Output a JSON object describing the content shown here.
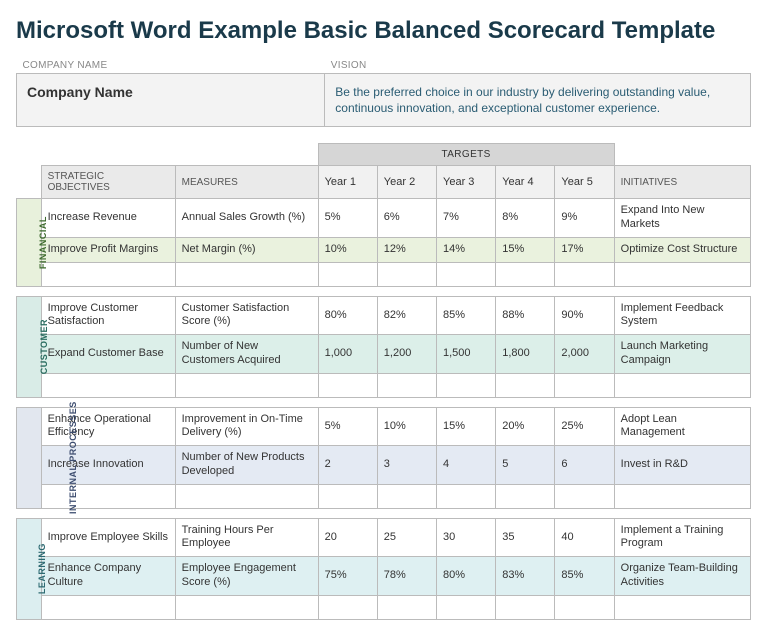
{
  "title": "Microsoft Word Example Basic Balanced Scorecard Template",
  "header": {
    "companyLabel": "COMPANY NAME",
    "visionLabel": "VISION",
    "companyName": "Company Name",
    "vision": "Be the preferred choice in our industry by delivering outstanding value, continuous innovation, and exceptional customer experience."
  },
  "columns": {
    "objectives": "STRATEGIC OBJECTIVES",
    "measures": "MEASURES",
    "targets": "TARGETS",
    "year1": "Year 1",
    "year2": "Year 2",
    "year3": "Year 3",
    "year4": "Year 4",
    "year5": "Year 5",
    "initiatives": "INITIATIVES"
  },
  "sections": {
    "financial": {
      "label": "FINANCIAL",
      "rows": [
        {
          "obj": "Increase Revenue",
          "mea": "Annual Sales Growth (%)",
          "y1": "5%",
          "y2": "6%",
          "y3": "7%",
          "y4": "8%",
          "y5": "9%",
          "ini": "Expand Into New Markets"
        },
        {
          "obj": "Improve Profit Margins",
          "mea": "Net Margin (%)",
          "y1": "10%",
          "y2": "12%",
          "y3": "14%",
          "y4": "15%",
          "y5": "17%",
          "ini": "Optimize Cost Structure"
        }
      ]
    },
    "customer": {
      "label": "CUSTOMER",
      "rows": [
        {
          "obj": "Improve Customer Satisfaction",
          "mea": "Customer Satisfaction Score (%)",
          "y1": "80%",
          "y2": "82%",
          "y3": "85%",
          "y4": "88%",
          "y5": "90%",
          "ini": "Implement Feedback System"
        },
        {
          "obj": "Expand Customer Base",
          "mea": "Number of New Customers Acquired",
          "y1": "1,000",
          "y2": "1,200",
          "y3": "1,500",
          "y4": "1,800",
          "y5": "2,000",
          "ini": "Launch Marketing Campaign"
        }
      ]
    },
    "internal": {
      "label": "INTERNAL PROCESSES",
      "rows": [
        {
          "obj": "Enhance Operational Efficiency",
          "mea": "Improvement in On-Time Delivery (%)",
          "y1": "5%",
          "y2": "10%",
          "y3": "15%",
          "y4": "20%",
          "y5": "25%",
          "ini": "Adopt Lean Management"
        },
        {
          "obj": "Increase Innovation",
          "mea": "Number of New Products Developed",
          "y1": "2",
          "y2": "3",
          "y3": "4",
          "y4": "5",
          "y5": "6",
          "ini": "Invest in R&D"
        }
      ]
    },
    "learning": {
      "label": "LEARNING",
      "rows": [
        {
          "obj": "Improve Employee Skills",
          "mea": "Training Hours Per Employee",
          "y1": "20",
          "y2": "25",
          "y3": "30",
          "y4": "35",
          "y5": "40",
          "ini": "Implement a Training Program"
        },
        {
          "obj": "Enhance Company Culture",
          "mea": "Employee Engagement Score (%)",
          "y1": "75%",
          "y2": "78%",
          "y3": "80%",
          "y4": "83%",
          "y5": "85%",
          "ini": "Organize Team-Building Activities"
        }
      ]
    }
  }
}
